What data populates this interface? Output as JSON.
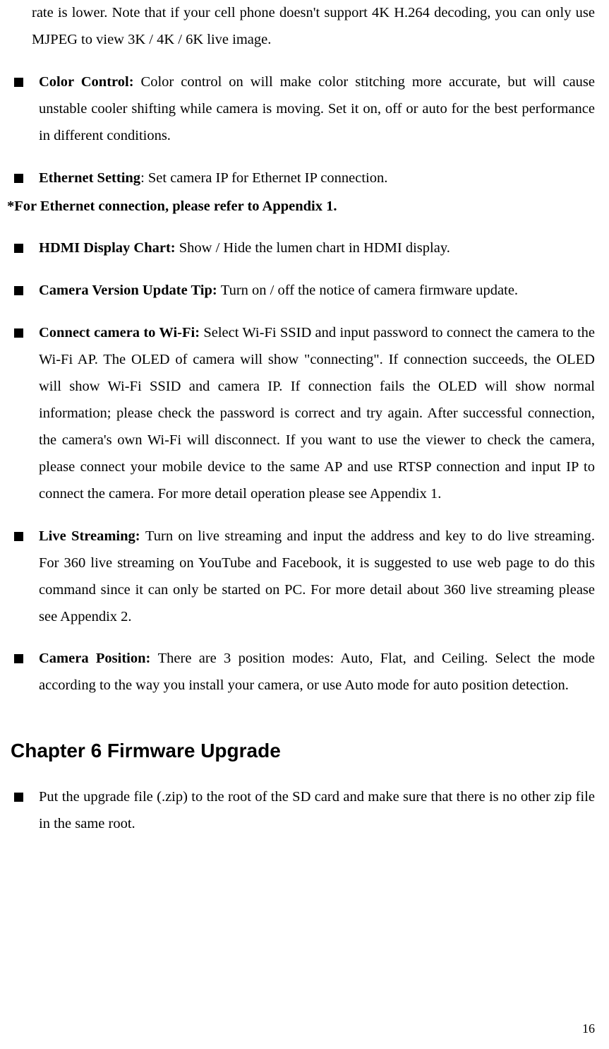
{
  "topFragment": "rate is lower. Note that if your cell phone doesn't support 4K H.264 decoding, you can only use MJPEG to view 3K / 4K / 6K live image.",
  "items": [
    {
      "title": "Color Control: ",
      "body": "Color control on will make color stitching more accurate, but will cause unstable cooler shifting while camera is moving. Set it on, off or auto for the best performance in different conditions."
    },
    {
      "title": "Ethernet Setting",
      "body": ": Set camera IP for Ethernet IP connection."
    }
  ],
  "ethernetNote": "*For Ethernet connection, please refer to Appendix 1.",
  "items2": [
    {
      "title": "HDMI Display Chart: ",
      "body": "Show / Hide the lumen chart in HDMI display."
    },
    {
      "title": "Camera Version Update Tip: ",
      "body": "Turn on / off the notice of camera firmware update."
    },
    {
      "title": "Connect camera to Wi-Fi: ",
      "body": "Select Wi-Fi SSID and input password to connect the camera to the Wi-Fi AP. The OLED of camera will show \"connecting\". If connection succeeds, the OLED will show Wi-Fi SSID and camera IP. If connection fails the OLED will show normal information; please check the password is correct and try again. After successful connection, the camera's own Wi-Fi will disconnect. If you want to use the viewer to check the camera, please connect your mobile device to the same AP and use RTSP connection and input IP to connect the camera. For more detail operation please see Appendix 1."
    },
    {
      "title": "Live Streaming: ",
      "body": "Turn on live streaming and input the address and key to do live streaming. For 360 live streaming on YouTube and Facebook, it is suggested to use web page to do this command since it can only be started on PC. For more detail about 360 live streaming please see Appendix 2."
    },
    {
      "title": "Camera Position: ",
      "body": "There are 3 position modes: Auto, Flat, and Ceiling. Select the mode according to the way you install your camera, or use Auto mode for auto position detection."
    }
  ],
  "chapterHeading": "Chapter 6 Firmware Upgrade",
  "chapterItems": [
    {
      "body": "Put the upgrade file (.zip) to the root of the SD card and make sure that there is no other zip file in the same root."
    }
  ],
  "pageNumber": "16"
}
